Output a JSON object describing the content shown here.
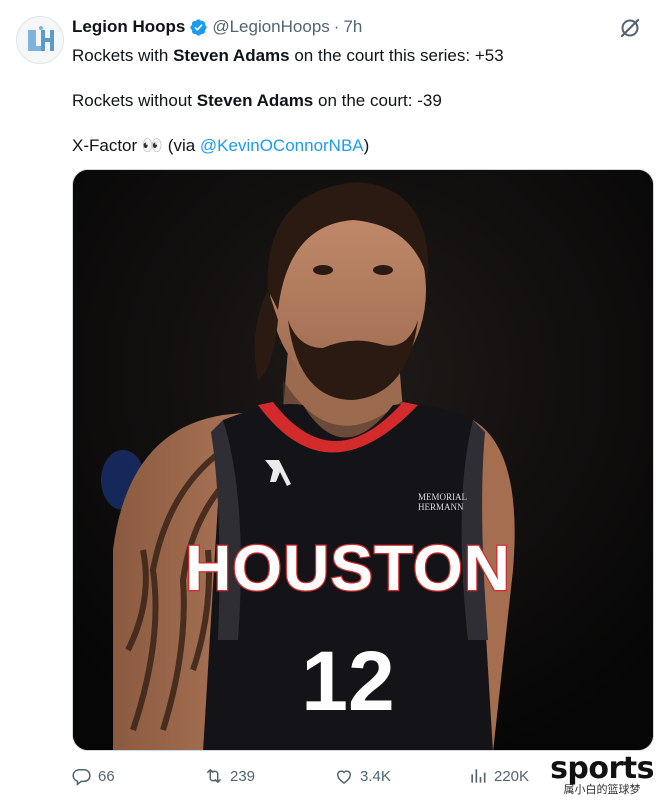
{
  "tweet": {
    "display_name": "Legion Hoops",
    "handle": "@LegionHoops",
    "separator": "·",
    "time": "7h",
    "verified_color": "#1d9bf0",
    "line1": {
      "prefix": "Rockets with ",
      "bold": "Steven Adams",
      "suffix": " on the court this series: +53"
    },
    "line2": {
      "prefix": "Rockets without ",
      "bold": "Steven Adams",
      "suffix": " on the court: -39"
    },
    "line3": {
      "prefix": "X-Factor 👀 (via ",
      "mention": "@KevinOConnorNBA",
      "suffix": ")"
    }
  },
  "media": {
    "jersey_team": "HOUSTON",
    "jersey_number": "12",
    "patch_text_1": "MEMORIAL",
    "patch_text_2": "HERMANN"
  },
  "actions": {
    "replies": "66",
    "retweets": "239",
    "likes": "3.4K",
    "views": "220K"
  },
  "watermark": {
    "main": "sports",
    "sub": "属小白的篮球梦"
  },
  "icons": {
    "reply": "reply-icon",
    "retweet": "retweet-icon",
    "like": "heart-icon",
    "views": "views-icon",
    "grok": "grok-icon",
    "verified": "verified-badge-icon"
  },
  "colors": {
    "link": "#1d9bf0",
    "muted": "#536471",
    "text": "#0f1419"
  }
}
